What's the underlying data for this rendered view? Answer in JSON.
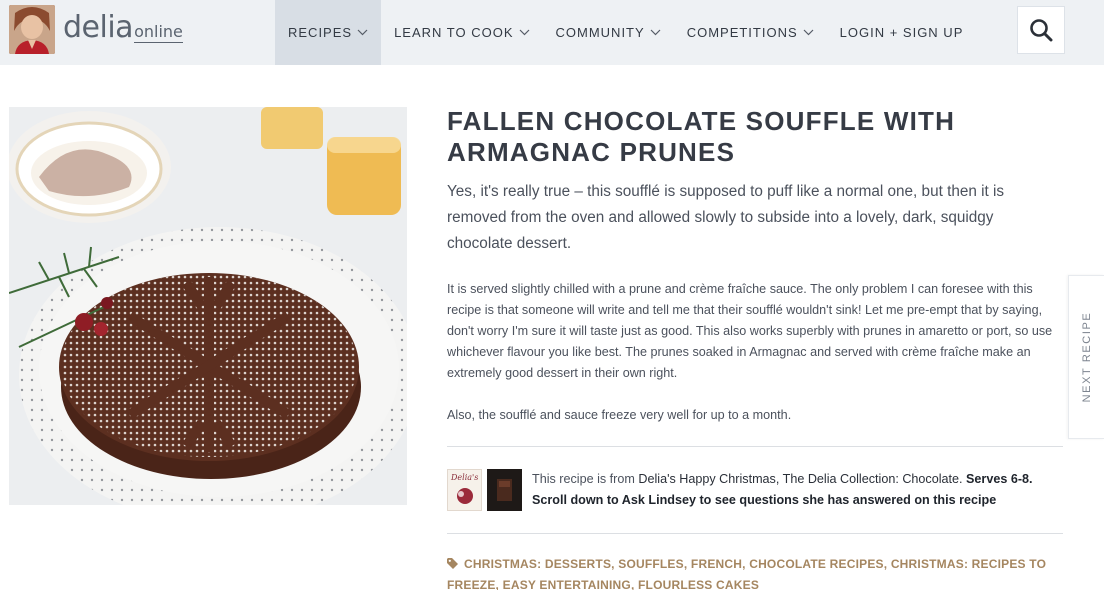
{
  "header": {
    "brand_main": "delia",
    "brand_sub": "online",
    "nav": [
      {
        "label": "RECIPES",
        "active": true
      },
      {
        "label": "LEARN TO COOK",
        "active": false
      },
      {
        "label": "COMMUNITY",
        "active": false
      },
      {
        "label": "COMPETITIONS",
        "active": false
      },
      {
        "label": "LOGIN + SIGN UP",
        "active": false
      }
    ]
  },
  "recipe": {
    "title_line1": "FALLEN CHOCOLATE SOUFFLE WITH",
    "title_line2": "ARMAGNAC PRUNES",
    "intro": "Yes, it's really true – this soufflé is supposed to puff like a normal one, but then it is removed from the oven and allowed slowly to subside into a lovely, dark, squidgy chocolate dessert.",
    "para1": "It is served slightly chilled with a prune and crème fraîche sauce. The only problem I can foresee with this recipe is that someone will write and tell me that their soufflé wouldn't sink! Let me pre-empt that by saying, don't worry I'm sure it will taste just as good. This also works superbly with prunes in amaretto or port, so use whichever flavour you like best. The prunes soaked in Armagnac and served with crème fraîche make an extremely good dessert in their own right.",
    "para2": "Also, the soufflé and sauce freeze very well for up to a month.",
    "source_prefix": "This recipe is from ",
    "source_books": "Delia's Happy Christmas, The Delia Collection: Chocolate.",
    "source_bold": "Serves 6-8. Scroll down to Ask Lindsey to see questions she has answered on this recipe",
    "book1_label": "Delia's"
  },
  "tags": [
    "CHRISTMAS: DESSERTS",
    "SOUFFLES",
    "FRENCH",
    "CHOCOLATE RECIPES",
    "CHRISTMAS: RECIPES TO FREEZE",
    "EASY ENTERTAINING",
    "FLOURLESS CAKES"
  ],
  "side": {
    "next_label": "NEXT RECIPE"
  },
  "colors": {
    "header_bg": "#eef1f4",
    "nav_active_bg": "#d8dee5",
    "tag_color": "#a58660"
  },
  "icons": {
    "search": "search-icon",
    "chevron": "chevron-down-icon",
    "tag": "tag-icon"
  }
}
